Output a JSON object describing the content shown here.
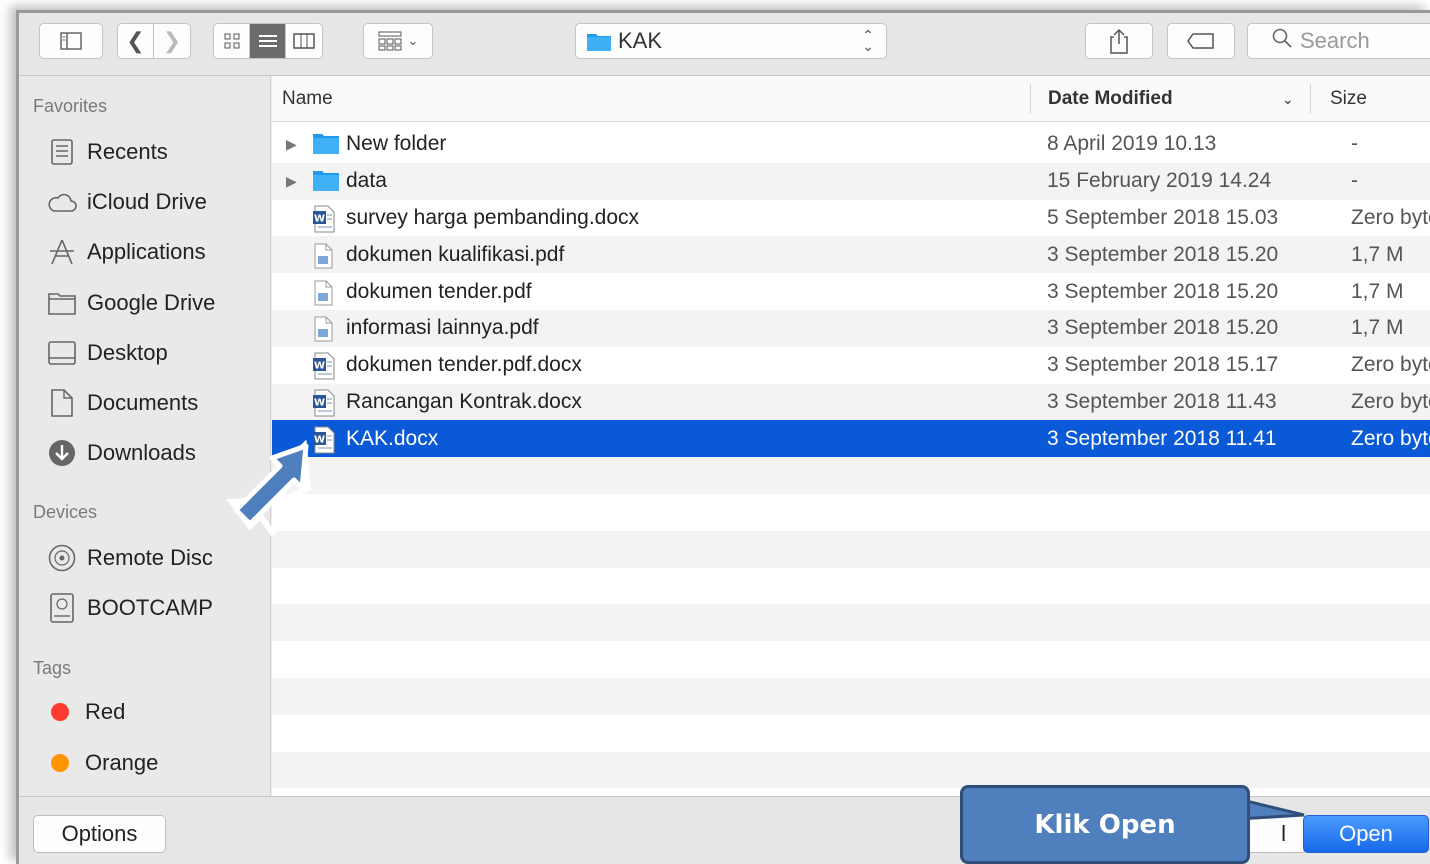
{
  "toolbar": {
    "location": "KAK",
    "search_placeholder": "Search"
  },
  "sidebar": {
    "favorites_heading": "Favorites",
    "favorites": [
      {
        "label": "Recents",
        "icon": "recents-icon"
      },
      {
        "label": "iCloud Drive",
        "icon": "cloud-icon"
      },
      {
        "label": "Applications",
        "icon": "applications-icon"
      },
      {
        "label": "Google Drive",
        "icon": "folder-icon"
      },
      {
        "label": "Desktop",
        "icon": "desktop-icon"
      },
      {
        "label": "Documents",
        "icon": "documents-icon"
      },
      {
        "label": "Downloads",
        "icon": "downloads-icon"
      }
    ],
    "devices_heading": "Devices",
    "devices": [
      {
        "label": "Remote Disc",
        "icon": "disc-icon"
      },
      {
        "label": "BOOTCAMP",
        "icon": "drive-icon"
      }
    ],
    "tags_heading": "Tags",
    "tags": [
      {
        "label": "Red",
        "color": "#ff3b30"
      },
      {
        "label": "Orange",
        "color": "#ff9500"
      }
    ]
  },
  "list": {
    "columns": {
      "name": "Name",
      "date": "Date Modified",
      "size": "Size"
    },
    "files": [
      {
        "name": "New folder",
        "date": "8 April 2019 10.13",
        "size": "-",
        "kind": "folder"
      },
      {
        "name": "data",
        "date": "15 February 2019 14.24",
        "size": "-",
        "kind": "folder"
      },
      {
        "name": "survey harga pembanding.docx",
        "date": "5 September 2018 15.03",
        "size": "Zero byte",
        "kind": "docx"
      },
      {
        "name": "dokumen kualifikasi.pdf",
        "date": "3 September 2018 15.20",
        "size": "1,7 M",
        "kind": "pdf"
      },
      {
        "name": "dokumen tender.pdf",
        "date": "3 September 2018 15.20",
        "size": "1,7 M",
        "kind": "pdf"
      },
      {
        "name": "informasi lainnya.pdf",
        "date": "3 September 2018 15.20",
        "size": "1,7 M",
        "kind": "pdf"
      },
      {
        "name": "dokumen tender.pdf.docx",
        "date": "3 September 2018 15.17",
        "size": "Zero byte",
        "kind": "docx"
      },
      {
        "name": "Rancangan Kontrak.docx",
        "date": "3 September 2018 11.43",
        "size": "Zero byte",
        "kind": "docx"
      },
      {
        "name": "KAK.docx",
        "date": "3 September 2018 11.41",
        "size": "Zero byte",
        "kind": "docx",
        "selected": true
      }
    ],
    "empty_rows": 9
  },
  "bottom": {
    "options": "Options",
    "cancel": "l",
    "open": "Open"
  },
  "annotation": {
    "callout": "Klik Open",
    "color": "#4f7fbd"
  }
}
